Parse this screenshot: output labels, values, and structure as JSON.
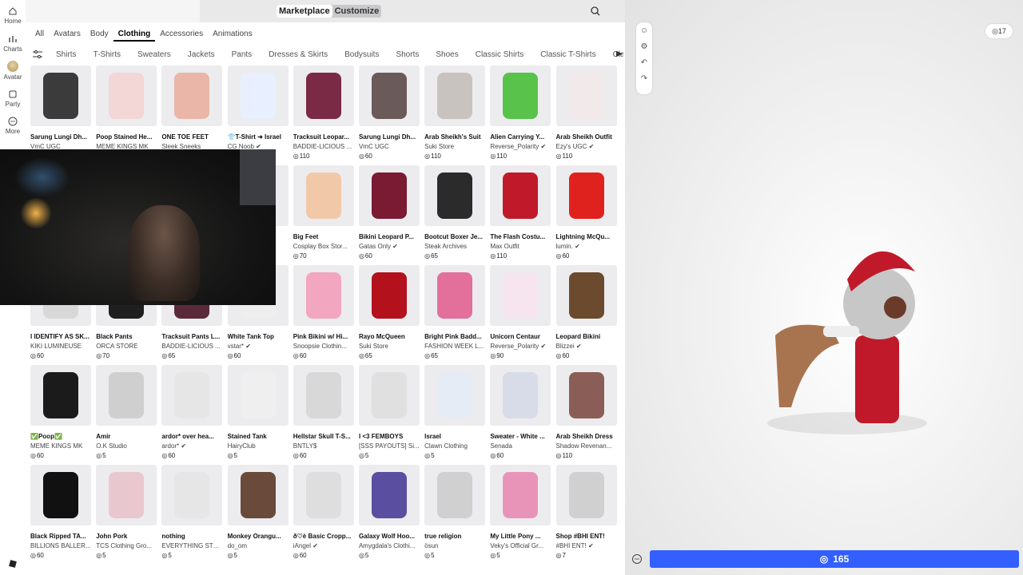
{
  "rail": {
    "items": [
      {
        "label": "Home",
        "icon": "home-icon"
      },
      {
        "label": "Charts",
        "icon": "charts-icon"
      },
      {
        "label": "Avatar",
        "icon": "avatar-icon"
      },
      {
        "label": "Party",
        "icon": "party-icon"
      },
      {
        "label": "More",
        "icon": "more-icon"
      }
    ]
  },
  "topbar": {
    "marketplace": "Marketplace",
    "customize": "Customize"
  },
  "categories": [
    "All",
    "Avatars",
    "Body",
    "Clothing",
    "Accessories",
    "Animations"
  ],
  "selected_category": "Clothing",
  "subcategories": [
    "Shirts",
    "T-Shirts",
    "Sweaters",
    "Jackets",
    "Pants",
    "Dresses & Skirts",
    "Bodysuits",
    "Shorts",
    "Shoes",
    "Classic Shirts",
    "Classic T-Shirts",
    "Cla"
  ],
  "items": [
    {
      "name": "Sarung Lungi Dh...",
      "creator": "VmC UGC",
      "price": ""
    },
    {
      "name": "Poop Stained He...",
      "creator": "MEME KINGS MK",
      "price": ""
    },
    {
      "name": "ONE TOE FEET",
      "creator": "Sleek Sneeks",
      "price": ""
    },
    {
      "name": "👕T-Shirt ➜ Israel",
      "creator": "CG Noob ✔",
      "price": ""
    },
    {
      "name": "Tracksuit Leopar...",
      "creator": "BADDIE-LICIOUS ...",
      "price": "110"
    },
    {
      "name": "Sarung Lungi Dh...",
      "creator": "VmC UGC",
      "price": "60"
    },
    {
      "name": "Arab Sheikh's Suit",
      "creator": "Suki Store",
      "price": "110"
    },
    {
      "name": "Alien Carrying Y...",
      "creator": "Reverse_Polarity ✔",
      "price": "110"
    },
    {
      "name": "Arab Sheikh Outfit",
      "creator": "Ezy's UGC ✔",
      "price": "110"
    },
    {
      "name": "",
      "creator": "",
      "price": ""
    },
    {
      "name": "",
      "creator": "",
      "price": ""
    },
    {
      "name": "",
      "creator": "",
      "price": ""
    },
    {
      "name": "",
      "creator": "",
      "price": ""
    },
    {
      "name": "Big Feet",
      "creator": "Cosplay Box Stor...",
      "price": "70"
    },
    {
      "name": "Bikini Leopard P...",
      "creator": "Gatas Only ✔",
      "price": "60"
    },
    {
      "name": "Bootcut Boxer Je...",
      "creator": "Steak Archives",
      "price": "65"
    },
    {
      "name": "The Flash Costu...",
      "creator": "Max Outfit",
      "price": "110"
    },
    {
      "name": "Lightning McQu...",
      "creator": "lumin. ✔",
      "price": "60"
    },
    {
      "name": "I IDENTIFY AS SK...",
      "creator": "KIKI LUMINEUSE",
      "price": "60"
    },
    {
      "name": "Black Pants",
      "creator": "ORCA STORE",
      "price": "70"
    },
    {
      "name": "Tracksuit Pants L...",
      "creator": "BADDIE-LICIOUS ...",
      "price": "65"
    },
    {
      "name": "White Tank Top",
      "creator": "vstar* ✔",
      "price": "60"
    },
    {
      "name": "Pink Bikini w/ Hi...",
      "creator": "Snoopsie Clothin...",
      "price": "60"
    },
    {
      "name": "Rayo McQueen",
      "creator": "Suki Store",
      "price": "65"
    },
    {
      "name": "Bright Pink Badd...",
      "creator": "FASHION WEEK L...",
      "price": "65"
    },
    {
      "name": "Unicorn Centaur",
      "creator": "Reverse_Polarity ✔",
      "price": "90"
    },
    {
      "name": "Leopard Bikini",
      "creator": "Blizzei ✔",
      "price": "60"
    },
    {
      "name": "✅Poop✅",
      "creator": "MEME KINGS MK",
      "price": "60"
    },
    {
      "name": "Amir",
      "creator": "O.K Studio",
      "price": "5"
    },
    {
      "name": "ardor* over hea...",
      "creator": "ardor* ✔",
      "price": "60"
    },
    {
      "name": "Stained Tank",
      "creator": "HairyClub",
      "price": "5"
    },
    {
      "name": "Hellstar Skull T-S...",
      "creator": "BNTLY$",
      "price": "60"
    },
    {
      "name": "I <3 FEMBOYS",
      "creator": "[SSS PAYOUTS] Si...",
      "price": "5"
    },
    {
      "name": "Israel",
      "creator": "Clawn Clothing",
      "price": "5"
    },
    {
      "name": "Sweater - White ...",
      "creator": "Senada",
      "price": "60"
    },
    {
      "name": "Arab Sheikh Dress",
      "creator": "Shadow Revenan...",
      "price": "110"
    },
    {
      "name": "Black Ripped TA...",
      "creator": "BILLIONS BALLER...",
      "price": "60"
    },
    {
      "name": "John Pork",
      "creator": "TCS Clothing Gro...",
      "price": "5"
    },
    {
      "name": "nothing",
      "creator": "EVERYTHING STO...",
      "price": "5"
    },
    {
      "name": "Monkey Orangu...",
      "creator": "do_om",
      "price": "5"
    },
    {
      "name": "ð♡è Basic Cropp...",
      "creator": "iAngel ✔",
      "price": "60"
    },
    {
      "name": "Galaxy Wolf Hoo...",
      "creator": "Amygdala's Clothi...",
      "price": "5"
    },
    {
      "name": "true religion",
      "creator": "ösun",
      "price": "5"
    },
    {
      "name": "My Little Pony ...",
      "creator": "Veky's Official Gr...",
      "price": "5"
    },
    {
      "name": "Shop #BHI ENT!",
      "creator": "#BHI ENT! ✔",
      "price": "7"
    }
  ],
  "viewport": {
    "robux_balance": "17",
    "buy_total": "165"
  }
}
